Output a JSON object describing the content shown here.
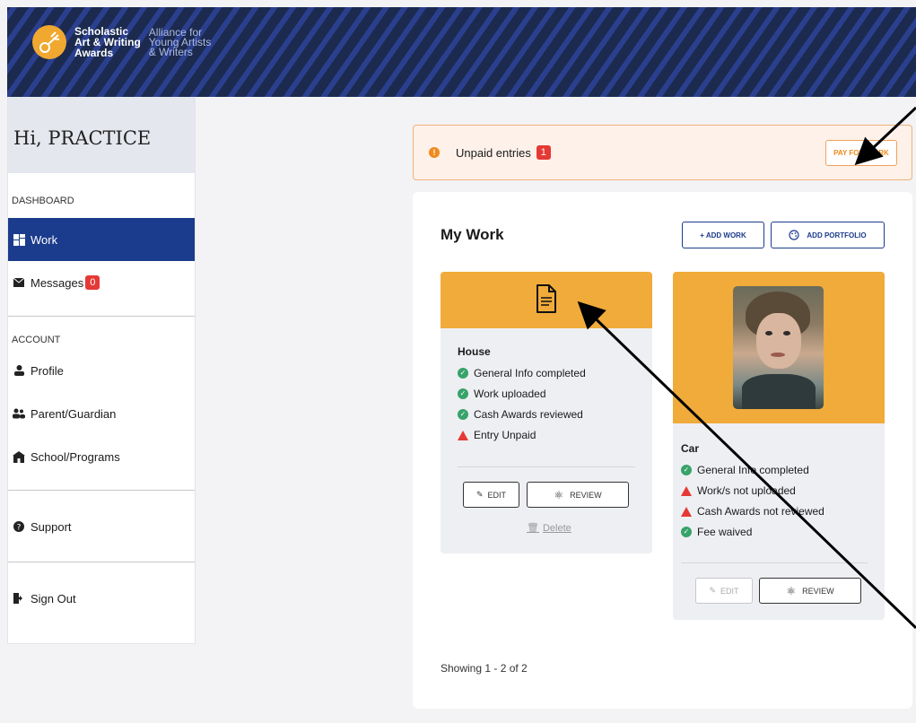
{
  "header": {
    "logo_line1": "Scholastic",
    "logo_line2": "Art & Writing",
    "logo_line3": "Awards",
    "alliance_line1": "Alliance for",
    "alliance_line2": "Young Artists",
    "alliance_line3": "& Writers"
  },
  "sidebar": {
    "greeting": "Hi, PRACTICE",
    "dashboard_section": "DASHBOARD",
    "account_section": "ACCOUNT",
    "items": [
      {
        "label": "Work",
        "icon": "grid-icon"
      },
      {
        "label": "Messages",
        "icon": "envelope-icon",
        "badge": "0"
      },
      {
        "label": "Profile",
        "icon": "user-icon"
      },
      {
        "label": "Parent/Guardian",
        "icon": "users-icon"
      },
      {
        "label": "School/Programs",
        "icon": "school-icon"
      },
      {
        "label": "Support",
        "icon": "question-icon"
      },
      {
        "label": "Sign Out",
        "icon": "sign-out-icon"
      }
    ]
  },
  "alert": {
    "text": "Unpaid entries",
    "count": "1",
    "button": "PAY FOR WORK"
  },
  "main": {
    "title": "My Work",
    "add_work": "+ ADD WORK",
    "add_portfolio": "ADD PORTFOLIO",
    "showing": "Showing 1 - 2 of 2"
  },
  "cards": [
    {
      "title": "House",
      "items": [
        {
          "status": "ok",
          "text": "General Info completed"
        },
        {
          "status": "ok",
          "text": "Work uploaded"
        },
        {
          "status": "ok",
          "text": "Cash Awards reviewed"
        },
        {
          "status": "warn",
          "text": "Entry Unpaid"
        }
      ],
      "edit": "EDIT",
      "review": "REVIEW",
      "delete": "Delete"
    },
    {
      "title": "Car",
      "items": [
        {
          "status": "ok",
          "text": "General Info completed"
        },
        {
          "status": "warn",
          "text": "Work/s not uploaded"
        },
        {
          "status": "warn",
          "text": "Cash Awards not reviewed"
        },
        {
          "status": "ok",
          "text": "Fee waived"
        }
      ],
      "edit": "EDIT",
      "review": "REVIEW"
    }
  ],
  "colors": {
    "nav_active": "#1b3b8c",
    "card_header": "#f0ab3a",
    "alert_bg": "#fdf1ea",
    "ok": "#37a36a",
    "warn": "#e53935"
  }
}
